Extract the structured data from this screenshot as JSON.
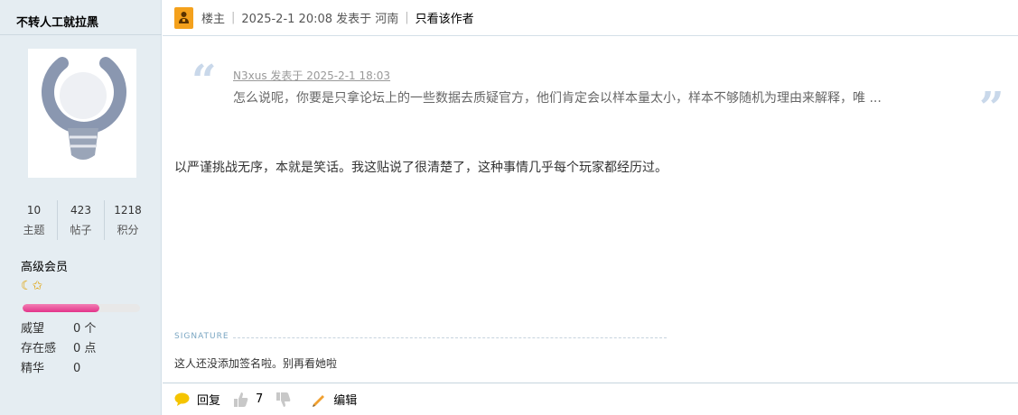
{
  "author": {
    "username": "不转人工就拉黑",
    "stats": [
      {
        "value": "10",
        "label": "主题"
      },
      {
        "value": "423",
        "label": "帖子"
      },
      {
        "value": "1218",
        "label": "积分"
      }
    ],
    "rank": "高级会员",
    "rank_icons": "☾✩",
    "level_progress": 0.65,
    "extra": [
      {
        "key": "威望",
        "value": "0 个"
      },
      {
        "key": "存在感",
        "value": "0 点"
      },
      {
        "key": "精华",
        "value": "0"
      }
    ]
  },
  "post_header": {
    "floor_label": "楼主",
    "posted_info": "2025-2-1 20:08 发表于 河南",
    "only_author": "只看该作者"
  },
  "quote": {
    "author_line": "N3xus 发表于 2025-2-1 18:03",
    "text": "怎么说呢，你要是只拿论坛上的一些数据去质疑官方，他们肯定会以样本量太小，样本不够随机为理由来解释，唯 ..."
  },
  "body": "以严谨挑战无序，本就是笑话。我这贴说了很清楚了，这种事情几乎每个玩家都经历过。",
  "signature": {
    "label": "SIGNATURE",
    "text": "这人还没添加签名啦。别再看她啦"
  },
  "footer": {
    "reply": "回复",
    "like_count": "7",
    "edit": "编辑"
  }
}
